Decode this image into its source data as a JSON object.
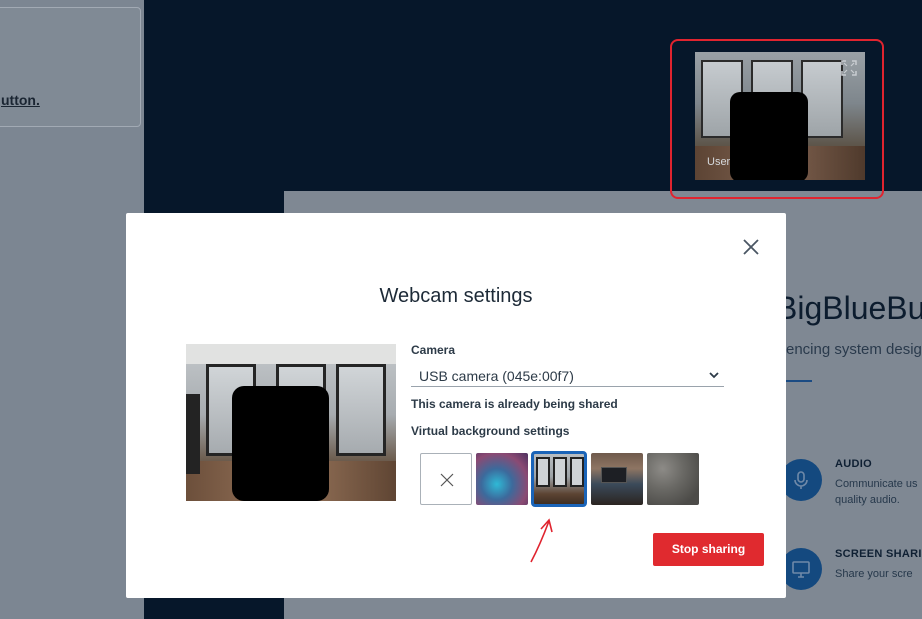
{
  "left_panel": {
    "text_visible": "utton",
    "trailing": "."
  },
  "welcome": {
    "title": "BigBlueBu",
    "subtitle": "encing system desig",
    "features": [
      {
        "title": "AUDIO",
        "lines": [
          "Communicate us",
          "quality audio."
        ],
        "icon": "microphone-icon"
      },
      {
        "title": "SCREEN SHARIN",
        "lines": [
          "Share your scre"
        ],
        "icon": "monitor-icon"
      }
    ]
  },
  "webcam_tile": {
    "user_label": "User"
  },
  "modal": {
    "title": "Webcam settings",
    "camera_label": "Camera",
    "camera_value": "USB camera (045e:00f7)",
    "shared_notice": "This camera is already being shared",
    "vb_label": "Virtual background settings",
    "virtual_backgrounds": [
      {
        "name": "none",
        "selected": false
      },
      {
        "name": "blur",
        "selected": false
      },
      {
        "name": "home",
        "selected": true
      },
      {
        "name": "coffeeshop",
        "selected": false
      },
      {
        "name": "board",
        "selected": false
      }
    ],
    "stop_button": "Stop sharing"
  },
  "colors": {
    "accent_blue": "#1a64b8",
    "danger_red": "#e02a2f",
    "annotation_red": "#e0242f"
  }
}
